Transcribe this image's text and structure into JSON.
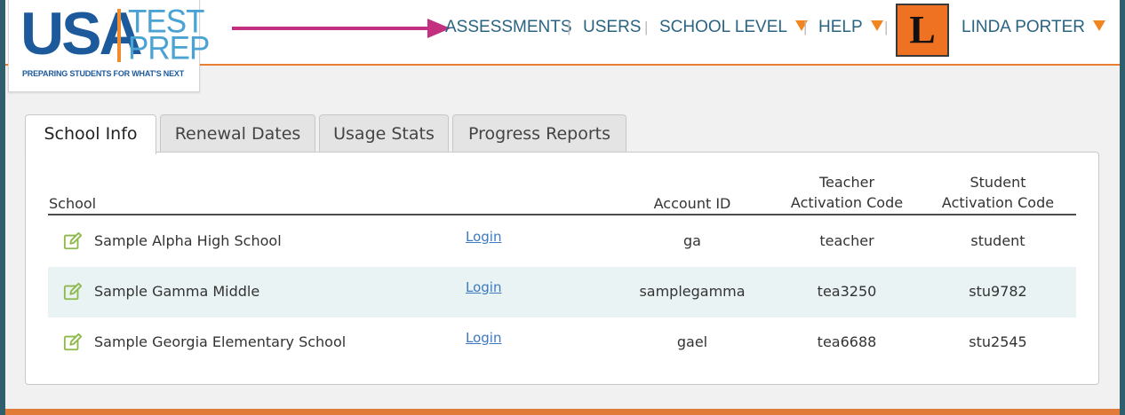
{
  "logo": {
    "usa": "USA",
    "test": "TEST",
    "prep": "PREP",
    "tagline": "PREPARING STUDENTS FOR WHAT'S NEXT"
  },
  "nav": {
    "assessments": "ASSESSMENTS",
    "users": "USERS",
    "school_level": "SCHOOL LEVEL",
    "help": "HELP",
    "avatar_initial": "L",
    "user_name": "LINDA PORTER",
    "separator": "|"
  },
  "tabs": [
    {
      "label": "School Info",
      "active": true
    },
    {
      "label": "Renewal Dates",
      "active": false
    },
    {
      "label": "Usage Stats",
      "active": false
    },
    {
      "label": "Progress Reports",
      "active": false
    }
  ],
  "table": {
    "headers": {
      "school": "School",
      "account_id": "Account ID",
      "teacher_code_line1": "Teacher",
      "teacher_code_line2": "Activation Code",
      "student_code_line1": "Student",
      "student_code_line2": "Activation Code"
    },
    "rows": [
      {
        "school": "Sample Alpha High School",
        "login": "Login",
        "account_id": "ga",
        "teacher_code": "teacher",
        "student_code": "student"
      },
      {
        "school": "Sample Gamma Middle",
        "login": "Login",
        "account_id": "samplegamma",
        "teacher_code": "tea3250",
        "student_code": "stu9782"
      },
      {
        "school": "Sample Georgia Elementary School",
        "login": "Login",
        "account_id": "gael",
        "teacher_code": "tea6688",
        "student_code": "stu2545"
      }
    ]
  },
  "icons": {
    "edit": "edit-pencil-icon",
    "caret": "caret-down-icon"
  },
  "colors": {
    "accent_orange": "#ea7d34",
    "annotation_arrow": "#c2307f",
    "nav_text": "#2a6482",
    "link": "#3c79c0",
    "edit_icon": "#8db84a",
    "row_alt": "#eaf3f4"
  }
}
